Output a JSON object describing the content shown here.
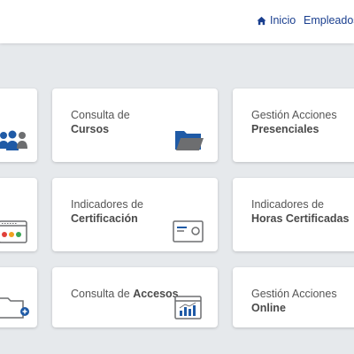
{
  "nav": {
    "home_label": "Inicio",
    "employees_label": "Empleados"
  },
  "cards": [
    {
      "line1": "Consulta de",
      "line2_bold": "Cursos"
    },
    {
      "line1": "Gestión Acciones",
      "line2_bold": "Presenciales"
    },
    {
      "line1": "Indicadores de",
      "line2_bold": "Certificación"
    },
    {
      "line1": "Indicadores de",
      "line2_bold": "Horas Certificadas"
    },
    {
      "line1_prefix": "Consulta de ",
      "line1_bold": "Accesos"
    },
    {
      "line1": "Gestión Acciones",
      "line2_bold": "Online"
    }
  ],
  "colors": {
    "nav_link": "#1a3f8f",
    "icon_blue": "#1f5aa6",
    "icon_gray": "#6d6e70",
    "background": "#e6e9ec"
  },
  "icons": [
    "home-icon",
    "users-icon",
    "folder-icon",
    "browser-icon",
    "certificate-icon",
    "folder-add-icon",
    "chart-window-icon"
  ]
}
